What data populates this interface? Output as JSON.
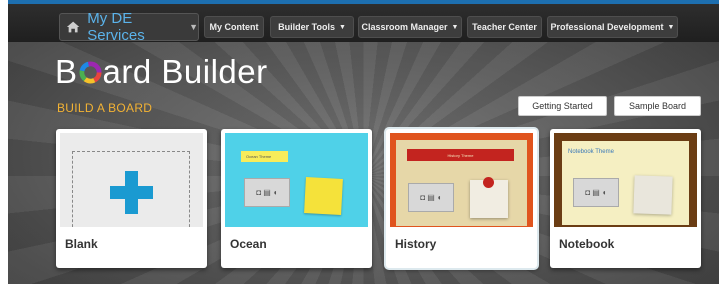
{
  "nav": {
    "services_label": "My DE Services",
    "items": [
      {
        "label": "My Content",
        "dropdown": false
      },
      {
        "label": "Builder Tools",
        "dropdown": true
      },
      {
        "label": "Classroom Manager",
        "dropdown": true
      },
      {
        "label": "Teacher Center",
        "dropdown": false
      },
      {
        "label": "Professional Development",
        "dropdown": true
      }
    ]
  },
  "header": {
    "logo_part1": "B",
    "logo_part2": "ard Builder",
    "subtitle": "BUILD A BOARD"
  },
  "actions": {
    "getting_started": "Getting Started",
    "sample_board": "Sample Board"
  },
  "themes": [
    {
      "label": "Blank"
    },
    {
      "label": "Ocean",
      "tag": "Ocean Theme"
    },
    {
      "label": "History",
      "tag": "History Theme"
    },
    {
      "label": "Notebook",
      "tag": "Notebook Theme"
    }
  ],
  "colors": {
    "accent": "#5bb3ea",
    "subtitle": "#f2b234",
    "ocean_bg": "#4fd1e8",
    "history_bg": "#e0541e",
    "notebook_bg": "#6b3d14",
    "plus": "#1a9ad1"
  }
}
